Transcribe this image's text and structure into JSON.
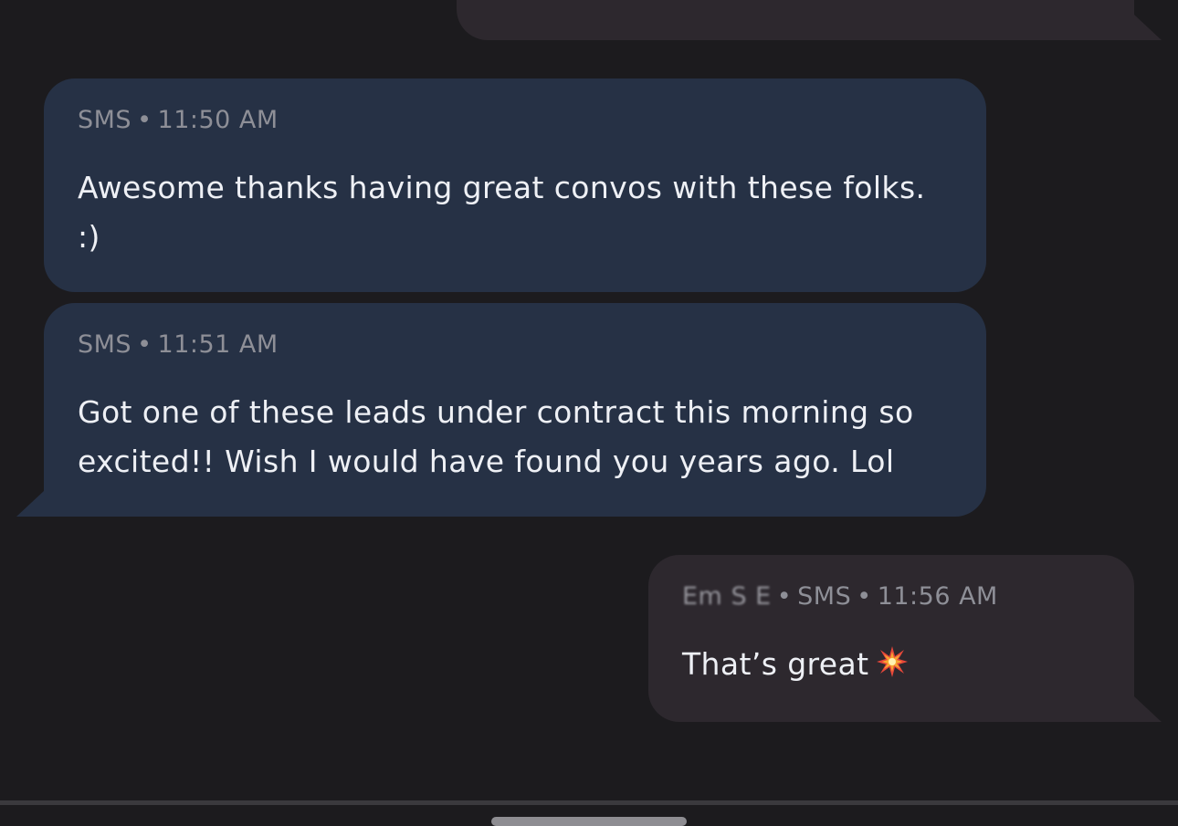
{
  "conversation": {
    "messages": [
      {
        "direction": "outgoing",
        "partial": true
      },
      {
        "direction": "incoming",
        "channel": "SMS",
        "separator": "•",
        "time": "11:50 AM",
        "text": "Awesome thanks having great convos with these folks. :)"
      },
      {
        "direction": "incoming",
        "channel": "SMS",
        "separator": "•",
        "time": "11:51 AM",
        "text": "Got one of these leads under contract this morning so excited!! Wish I would have found you years ago. Lol"
      },
      {
        "direction": "outgoing",
        "sender": "Em  S  E",
        "channel": "SMS",
        "separator": "•",
        "time": "11:56 AM",
        "text": "That’s great",
        "emoji_icon": "collision-icon"
      }
    ]
  },
  "colors": {
    "background": "#1c1b1e",
    "incoming_bubble": "#263145",
    "outgoing_bubble": "#2d282e",
    "meta_text": "#8e8f97",
    "body_text": "#eef0f5"
  }
}
